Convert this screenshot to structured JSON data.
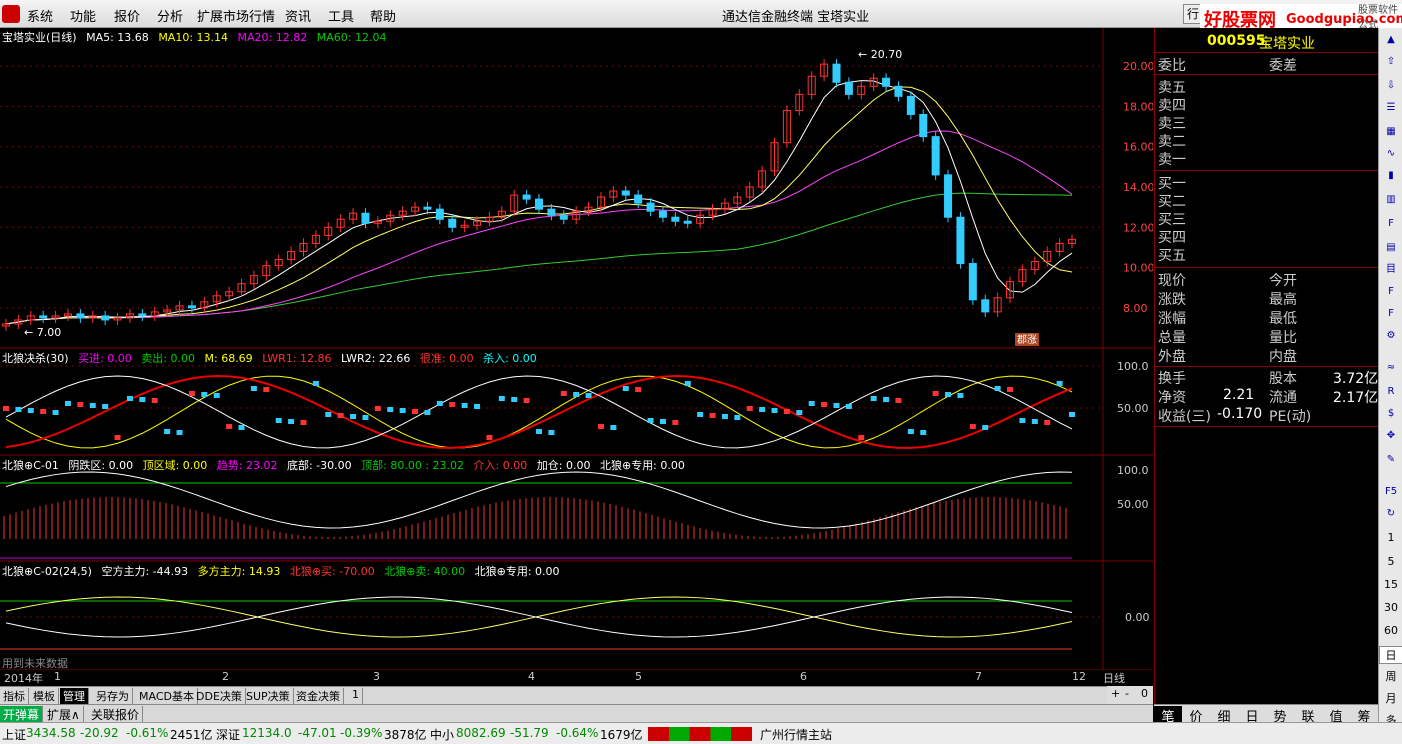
{
  "menu": {
    "items": [
      "系统",
      "功能",
      "报价",
      "分析",
      "扩展市场行情",
      "资讯",
      "工具",
      "帮助"
    ],
    "center_title": "通达信金融终端    宝塔实业",
    "tab": "行",
    "brand_main": "好股票网",
    "brand_site": "Goodgupiao.com",
    "brand_small": "股票软件公式"
  },
  "main_panel": {
    "title": "宝塔实业(日线)",
    "ma5": "MA5: 13.68",
    "ma10": "MA10: 13.14",
    "ma20": "MA20: 12.82",
    "ma60": "MA60: 12.04",
    "high_label": "20.70",
    "low_label": "7.00",
    "tag_label": "郡涨",
    "price_ticks": [
      "20.00",
      "18.00",
      "16.00",
      "14.00",
      "12.00",
      "10.00",
      "8.00"
    ]
  },
  "ind1": {
    "name": "北狼决杀(30)",
    "buy": "买进: 0.00",
    "sell": "卖出: 0.00",
    "m": "M: 68.69",
    "lwr1": "LWR1: 12.86",
    "lwr2": "LWR2: 22.66",
    "hen": "很准: 0.00",
    "kill": "杀入: 0.00",
    "ticks": [
      "100.0",
      "50.00"
    ]
  },
  "ind2": {
    "name": "北狼⊕C-01",
    "yin": "阴跌区: 0.00",
    "top": "顶区域: 0.00",
    "trend": "趋势: 23.02",
    "bottom": "底部: -30.00",
    "peak": "顶部: 80.00 : 23.02",
    "enter": "介入: 0.00",
    "add": "加仓: 0.00",
    "special": "北狼⊕专用: 0.00",
    "ticks": [
      "100.0",
      "50.00"
    ]
  },
  "ind3": {
    "name": "北狼⊕C-02(24,5)",
    "short": "空方主力: -44.93",
    "long": "多方主力: 14.93",
    "buy": "北狼⊕买: -70.00",
    "sell": "北狼⊕卖: 40.00",
    "special": "北狼⊕专用: 0.00",
    "ticks": [
      "0.00"
    ],
    "future_note": "用到未来数据"
  },
  "date_axis": {
    "year": "2014年",
    "months": [
      "1",
      "2",
      "3",
      "4",
      "5",
      "6",
      "7",
      "12"
    ],
    "period": "日线"
  },
  "bottom_tabs": [
    "指标",
    "模板",
    "管理",
    "另存为",
    "MACD基本",
    "DDE决策",
    "SUP决策",
    "资金决策",
    "1"
  ],
  "bottom_tabs2": [
    "开弹幕",
    "扩展∧",
    "关联报价"
  ],
  "period_controls": [
    "+",
    "-",
    "0"
  ],
  "quote": {
    "code": "000595",
    "name": "宝塔实业",
    "rows": {
      "weibi": "委比",
      "weicha": "委差",
      "sell5": "卖五",
      "sell4": "卖四",
      "sell3": "卖三",
      "sell2": "卖二",
      "sell1": "卖一",
      "buy1": "买一",
      "buy2": "买二",
      "buy3": "买三",
      "buy4": "买四",
      "buy5": "买五",
      "xianjia": "现价",
      "jinkai": "今开",
      "zhangdie": "涨跌",
      "zuigao": "最高",
      "zhangfu": "涨幅",
      "zuidi": "最低",
      "zongliang": "总量",
      "liangbi": "量比",
      "waipan": "外盘",
      "neipan": "内盘",
      "huanshou": "换手",
      "guben": "股本",
      "guben_val": "3.72亿",
      "jingzi": "净资",
      "jingzi_val": "2.21",
      "liutong": "流通",
      "liutong_val": "2.17亿",
      "shouyi": "收益(三)",
      "shouyi_val": "-0.170",
      "pe": "PE(动)"
    },
    "tabs": [
      "笔",
      "价",
      "细",
      "日",
      "势",
      "联",
      "值",
      "筹"
    ]
  },
  "right_toolbar": {
    "numbers": [
      "1",
      "5",
      "15",
      "30",
      "60",
      "日",
      "周",
      "月",
      "多"
    ]
  },
  "status": {
    "sh_name": "上证",
    "sh_val": "3434.58",
    "sh_chg": "-20.92",
    "sh_pct": "-0.61%",
    "sh_amt": "2451亿",
    "sz_name": "深证",
    "sz_val": "12134.0",
    "sz_chg": "-47.01",
    "sz_pct": "-0.39%",
    "sz_amt": "3878亿",
    "zx_name": "中小",
    "zx_val": "8082.69",
    "zx_chg": "-51.79",
    "zx_pct": "-0.64%",
    "zx_amt": "1679亿",
    "server": "广州行情主站"
  },
  "colors": {
    "up": "#ff3333",
    "down": "#33ccff",
    "ma5": "#ffffff",
    "ma10": "#ffff66",
    "ma20": "#ff44ff",
    "ma60": "#33cc33",
    "grid": "#800000"
  },
  "chart_data": {
    "type": "candlestick",
    "y_range": [
      7,
      21
    ],
    "closes": [
      7.2,
      7.4,
      7.6,
      7.5,
      7.6,
      7.7,
      7.5,
      7.6,
      7.4,
      7.5,
      7.7,
      7.6,
      7.8,
      7.9,
      8.1,
      8.0,
      8.3,
      8.6,
      8.8,
      9.2,
      9.6,
      10.1,
      10.4,
      10.8,
      11.2,
      11.6,
      12.0,
      12.4,
      12.7,
      12.2,
      12.3,
      12.6,
      12.8,
      13.0,
      12.9,
      12.4,
      12.0,
      12.1,
      12.3,
      12.5,
      12.8,
      13.6,
      13.4,
      12.9,
      12.6,
      12.4,
      12.8,
      13.0,
      13.5,
      13.8,
      13.6,
      13.2,
      12.8,
      12.5,
      12.3,
      12.2,
      12.6,
      12.9,
      13.2,
      13.5,
      14.0,
      14.8,
      16.2,
      17.8,
      18.6,
      19.5,
      20.1,
      19.2,
      18.6,
      19.0,
      19.4,
      19.0,
      18.5,
      17.6,
      16.5,
      14.6,
      12.5,
      10.2,
      8.4,
      7.8,
      8.5,
      9.3,
      9.9,
      10.3,
      10.8,
      11.2,
      11.4
    ]
  }
}
